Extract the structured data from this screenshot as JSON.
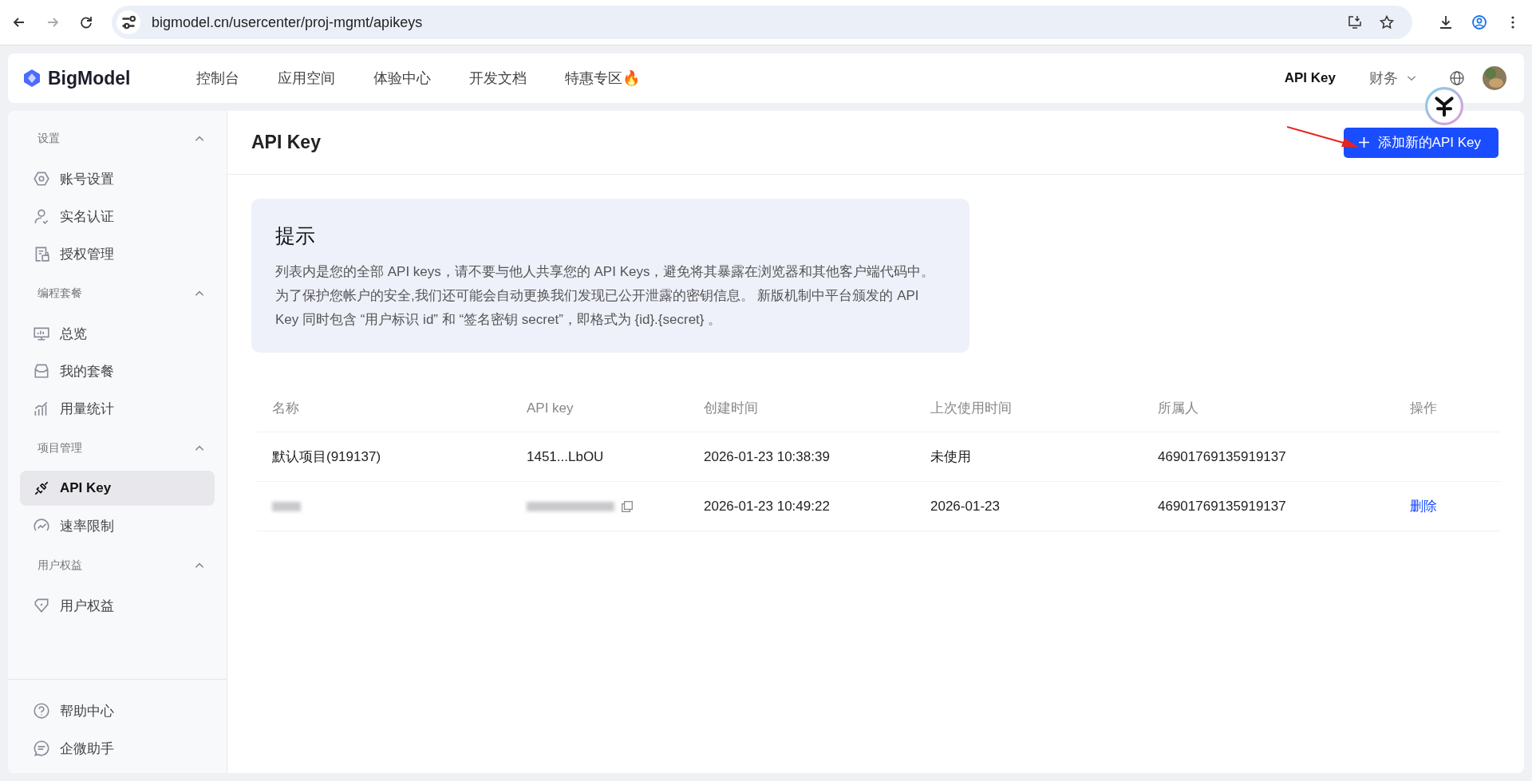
{
  "browser": {
    "url": "bigmodel.cn/usercenter/proj-mgmt/apikeys",
    "forward_disabled": true
  },
  "topnav": {
    "logo": "BigModel",
    "links": [
      {
        "label": "控制台"
      },
      {
        "label": "应用空间"
      },
      {
        "label": "体验中心"
      },
      {
        "label": "开发文档"
      },
      {
        "label": "特惠专区",
        "emoji": "🔥"
      }
    ],
    "api_key_link": "API Key",
    "finance_menu": "财务"
  },
  "sidebar": {
    "groups": [
      {
        "title": "设置",
        "expanded": true,
        "items": [
          {
            "label": "账号设置",
            "selected": false
          },
          {
            "label": "实名认证",
            "selected": false
          },
          {
            "label": "授权管理",
            "selected": false
          }
        ]
      },
      {
        "title": "编程套餐",
        "expanded": true,
        "items": [
          {
            "label": "总览",
            "selected": false
          },
          {
            "label": "我的套餐",
            "selected": false
          },
          {
            "label": "用量统计",
            "selected": false
          }
        ]
      },
      {
        "title": "项目管理",
        "expanded": true,
        "items": [
          {
            "label": "API Key",
            "selected": true
          },
          {
            "label": "速率限制",
            "selected": false
          }
        ]
      },
      {
        "title": "用户权益",
        "expanded": true,
        "items": [
          {
            "label": "用户权益",
            "selected": false
          }
        ]
      }
    ],
    "footer": [
      {
        "label": "帮助中心"
      },
      {
        "label": "企微助手"
      }
    ]
  },
  "page": {
    "title": "API Key",
    "add_button": "添加新的API Key",
    "tip": {
      "title": "提示",
      "text": "列表内是您的全部 API keys，请不要与他人共享您的 API Keys，避免将其暴露在浏览器和其他客户端代码中。为了保护您帐户的安全,我们还可能会自动更换我们发现已公开泄露的密钥信息。 新版机制中平台颁发的 API Key 同时包含 “用户标识 id” 和 “签名密钥 secret”，即格式为 {id}.{secret} 。"
    },
    "table": {
      "columns": [
        "名称",
        "API key",
        "创建时间",
        "上次使用时间",
        "所属人",
        "操作"
      ],
      "rows": [
        {
          "name": "默认项目(919137)",
          "name_redacted": false,
          "api_key": "1451...LbOU",
          "key_redacted": false,
          "created": "2026-01-23 10:38:39",
          "last_used": "未使用",
          "owner": "46901769135919137"
        },
        {
          "name_redacted": true,
          "key_redacted": true,
          "created": "2026-01-23 10:49:22",
          "last_used": "2026-01-23",
          "owner": "46901769135919137",
          "action": "删除"
        }
      ]
    }
  }
}
